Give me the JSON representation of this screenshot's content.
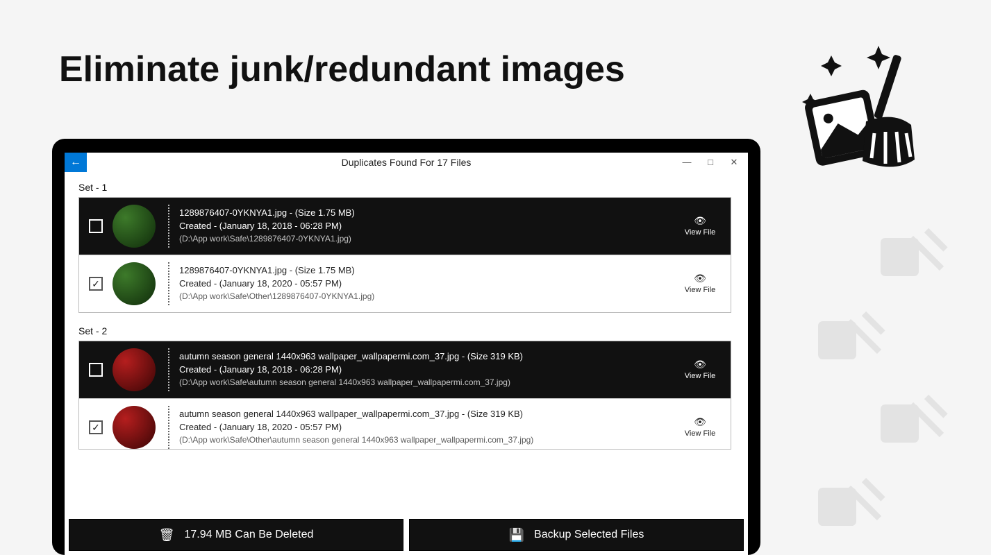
{
  "promo": {
    "headline": "Eliminate junk/redundant images"
  },
  "window": {
    "title": "Duplicates Found For 17 Files",
    "back_label": "←",
    "minimize": "—",
    "maximize": "□",
    "close": "✕"
  },
  "sets": [
    {
      "label": "Set - 1",
      "rows": [
        {
          "variant": "dark",
          "checked": false,
          "thumb": "green",
          "name_line": "1289876407-0YKNYA1.jpg - (Size 1.75 MB)",
          "created_line": "Created - (January 18, 2018 - 06:28 PM)",
          "path_line": "(D:\\App work\\Safe\\1289876407-0YKNYA1.jpg)",
          "view_label": "View File"
        },
        {
          "variant": "light",
          "checked": true,
          "thumb": "green",
          "name_line": "1289876407-0YKNYA1.jpg - (Size 1.75 MB)",
          "created_line": "Created - (January 18, 2020 - 05:57 PM)",
          "path_line": "(D:\\App work\\Safe\\Other\\1289876407-0YKNYA1.jpg)",
          "view_label": "View File"
        }
      ]
    },
    {
      "label": "Set - 2",
      "rows": [
        {
          "variant": "dark",
          "checked": false,
          "thumb": "red",
          "name_line": "autumn season general 1440x963 wallpaper_wallpapermi.com_37.jpg - (Size 319 KB)",
          "created_line": "Created - (January 18, 2018 - 06:28 PM)",
          "path_line": "(D:\\App work\\Safe\\autumn season general 1440x963 wallpaper_wallpapermi.com_37.jpg)",
          "view_label": "View File"
        },
        {
          "variant": "light",
          "checked": true,
          "thumb": "red",
          "name_line": "autumn season general 1440x963 wallpaper_wallpapermi.com_37.jpg - (Size 319 KB)",
          "created_line": "Created - (January 18, 2020 - 05:57 PM)",
          "path_line": "(D:\\App work\\Safe\\Other\\autumn season general 1440x963 wallpaper_wallpapermi.com_37.jpg)",
          "view_label": "View File"
        }
      ]
    }
  ],
  "actions": {
    "delete_label": "17.94 MB Can Be Deleted",
    "backup_label": "Backup Selected Files"
  },
  "icons": {
    "eye": "👁",
    "trash": "🗑",
    "save": "💾",
    "check": "✓"
  }
}
